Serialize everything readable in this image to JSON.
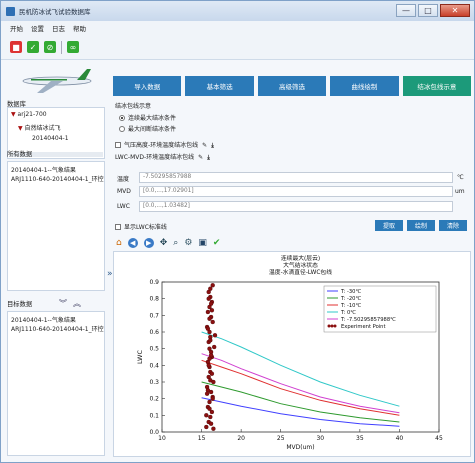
{
  "window": {
    "title": "民机防冰试飞试验数据库",
    "min": "—",
    "max": "□",
    "close": "✕"
  },
  "menu": [
    "开始",
    "设置",
    "日志",
    "帮助"
  ],
  "toolbar_icons": [
    "stop-icon",
    "confirm-icon",
    "cancel-icon",
    "link-icon"
  ],
  "left": {
    "db_label": "数据库",
    "tree": [
      "arj21-700",
      "自然结冰试飞",
      "20140404-1"
    ],
    "all_label": "所有数据",
    "all_items": [
      "20140404-1--气象结果",
      "ARJ1110-640-20140404-1_环控"
    ],
    "target_label": "目标数据",
    "target_items": [
      "20140404-1--气象结果",
      "ARJ1110-640-20140404-1_环控"
    ]
  },
  "tabs": [
    "导入数据",
    "基本筛选",
    "高级筛选",
    "曲线绘制",
    "结冰包线示意"
  ],
  "active_tab": 4,
  "env": {
    "title": "结冰包线示意",
    "radio1": "连续最大结冰条件",
    "radio2": "最大间断结冰条件",
    "chk1": "气压高度-环境温度结冰包线",
    "chk2": "LWC-MVD-环境温度结冰包线",
    "temp_label": "温度",
    "temp_value": "-7.50295857988",
    "temp_unit": "℃",
    "mvd_label": "MVD",
    "mvd_value": "[0.0,...,17.02901]",
    "mvd_unit": "um",
    "lwc_label": "LWC",
    "lwc_value": "[0.0,...,1.03482]",
    "show_std": "显示LWC标准线",
    "btn_extract": "提取",
    "btn_plot": "绘制",
    "btn_clear": "清除"
  },
  "chart_data": {
    "type": "scatter",
    "title": [
      "连续最大(层云)",
      "大气结冰状态",
      "温度-水滴直径-LWC包线"
    ],
    "xlabel": "MVD(um)",
    "ylabel": "LWC",
    "xlim": [
      10,
      45
    ],
    "ylim": [
      0,
      0.9
    ],
    "xticks": [
      10,
      15,
      20,
      25,
      30,
      35,
      40,
      45
    ],
    "yticks": [
      0,
      0.1,
      0.2,
      0.3,
      0.4,
      0.5,
      0.6,
      0.7,
      0.8,
      0.9
    ],
    "legend_position": "top-right",
    "series": [
      {
        "name": "T: -30℃",
        "color": "#4040ff",
        "x": [
          15,
          17.5,
          20,
          25,
          30,
          35,
          40
        ],
        "y": [
          0.205,
          0.18,
          0.155,
          0.11,
          0.075,
          0.05,
          0.035
        ]
      },
      {
        "name": "T: -20℃",
        "color": "#2e9a2e",
        "x": [
          15,
          17.5,
          20,
          25,
          30,
          35,
          40
        ],
        "y": [
          0.3,
          0.27,
          0.24,
          0.17,
          0.12,
          0.085,
          0.06
        ]
      },
      {
        "name": "T: -10℃",
        "color": "#e03030",
        "x": [
          15,
          17.5,
          20,
          25,
          30,
          35,
          40
        ],
        "y": [
          0.43,
          0.39,
          0.35,
          0.26,
          0.19,
          0.14,
          0.1
        ]
      },
      {
        "name": "T: 0℃",
        "color": "#30c8c8",
        "x": [
          15,
          17.5,
          20,
          25,
          30,
          35,
          40
        ],
        "y": [
          0.6,
          0.56,
          0.51,
          0.4,
          0.3,
          0.22,
          0.155
        ]
      },
      {
        "name": "T: -7.50295857988℃",
        "color": "#d040d0",
        "x": [
          15,
          17.5,
          20,
          25,
          30,
          35,
          40
        ],
        "y": [
          0.47,
          0.43,
          0.38,
          0.29,
          0.21,
          0.155,
          0.115
        ]
      }
    ],
    "points": {
      "name": "Experiment Point",
      "color": "#8b1010",
      "x": [
        15.6,
        15.9,
        16.1,
        16.3,
        15.8,
        16.0,
        16.4,
        16.2,
        15.7,
        16.5,
        15.9,
        16.1,
        16.0,
        15.8,
        16.3,
        16.2,
        16.6,
        15.9,
        16.1,
        16.0,
        15.7,
        16.4,
        16.2,
        15.8,
        16.0,
        16.3,
        16.1,
        15.9,
        16.5,
        16.2,
        15.6,
        16.0,
        16.4,
        15.8,
        16.1,
        16.3,
        15.9,
        16.2,
        16.0,
        16.1,
        16.7,
        15.8,
        16.0,
        16.3,
        16.2,
        15.9,
        16.1,
        16.4,
        16.0,
        15.7
      ],
      "y": [
        0.03,
        0.06,
        0.09,
        0.12,
        0.15,
        0.18,
        0.21,
        0.24,
        0.27,
        0.3,
        0.33,
        0.36,
        0.39,
        0.42,
        0.45,
        0.48,
        0.51,
        0.54,
        0.57,
        0.6,
        0.63,
        0.66,
        0.69,
        0.72,
        0.75,
        0.78,
        0.81,
        0.84,
        0.02,
        0.05,
        0.1,
        0.14,
        0.2,
        0.25,
        0.31,
        0.35,
        0.4,
        0.46,
        0.5,
        0.55,
        0.58,
        0.62,
        0.68,
        0.73,
        0.77,
        0.8,
        0.86,
        0.88,
        0.44,
        0.23
      ]
    }
  }
}
